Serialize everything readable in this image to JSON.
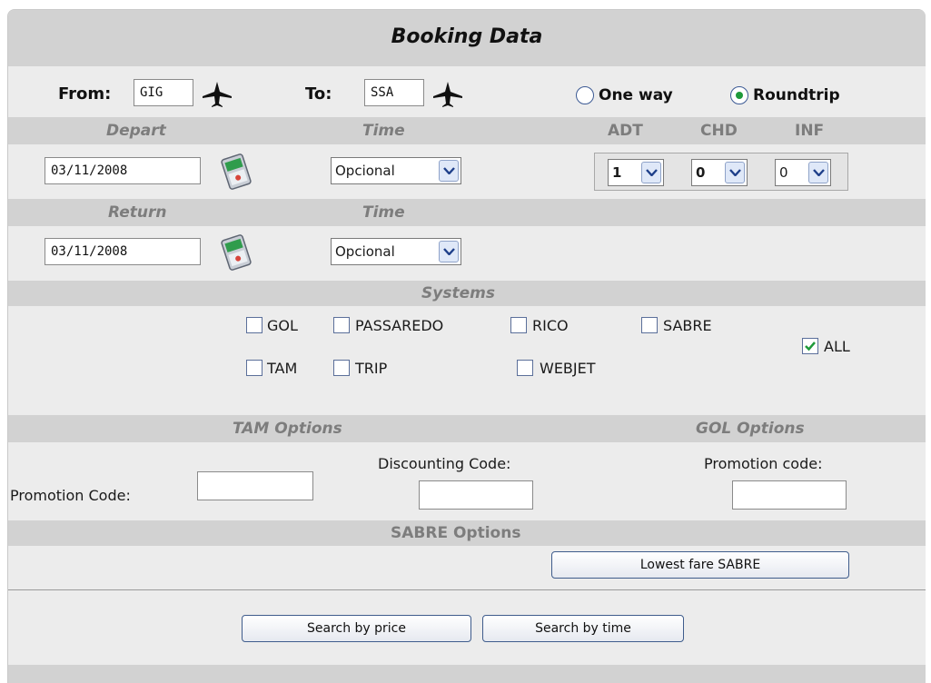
{
  "title": "Booking Data",
  "route": {
    "from_label": "From:",
    "from_value": "GIG",
    "to_label": "To:",
    "to_value": "SSA",
    "trip_one_way": "One way",
    "trip_roundtrip": "Roundtrip",
    "selected_trip": "Roundtrip"
  },
  "depart": {
    "label": "Depart",
    "time_label": "Time",
    "date": "03/11/2008",
    "time_value": "Opcional"
  },
  "passengers": {
    "adt_label": "ADT",
    "chd_label": "CHD",
    "inf_label": "INF",
    "adt": "1",
    "chd": "0",
    "inf": "0"
  },
  "return": {
    "label": "Return",
    "time_label": "Time",
    "date": "03/11/2008",
    "time_value": "Opcional"
  },
  "systems": {
    "label": "Systems",
    "gol": "GOL",
    "passaredo": "PASSAREDO",
    "rico": "RICO",
    "sabre": "SABRE",
    "tam": "TAM",
    "trip": "TRIP",
    "webjet": "WEBJET",
    "all": "ALL",
    "all_checked": true
  },
  "tam_options": {
    "label": "TAM Options",
    "promo_label": "Promotion Code:",
    "discount_label": "Discounting Code:"
  },
  "gol_options": {
    "label": "GOL Options",
    "promo_label": "Promotion code:"
  },
  "sabre_options": {
    "label": "SABRE Options",
    "lowest_fare_button": "Lowest fare SABRE"
  },
  "actions": {
    "search_price": "Search by price",
    "search_time": "Search by time"
  }
}
